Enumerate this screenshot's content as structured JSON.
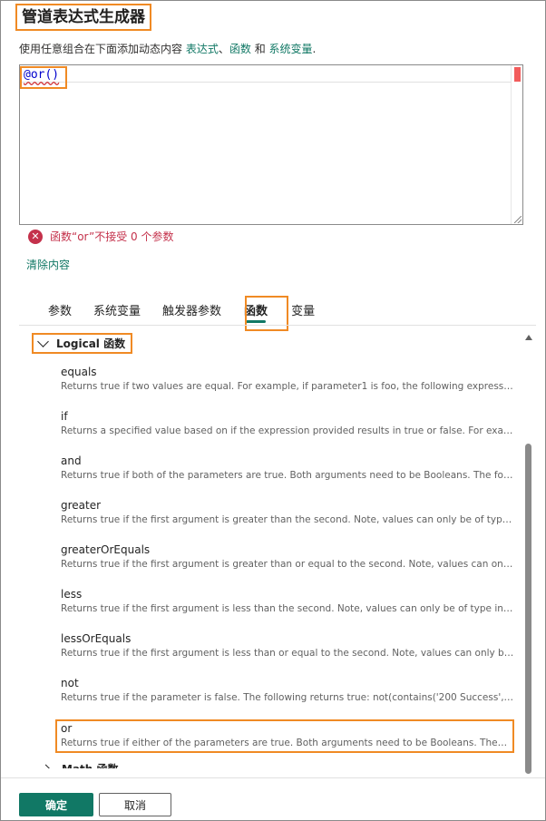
{
  "dialog": {
    "title": "管道表达式生成器",
    "description_prefix": "使用任意组合在下面添加动态内容 ",
    "link_expressions": "表达式",
    "separator": "、",
    "link_functions": "函数",
    "and_word": " 和 ",
    "link_system_variables": "系统变量",
    "description_suffix": "."
  },
  "editor": {
    "code": "@or()"
  },
  "error": {
    "icon": "error-circle-icon",
    "message": "函数“or”不接受 0 个参数"
  },
  "clear_label": "清除内容",
  "tabs": [
    {
      "label": "参数",
      "active": false
    },
    {
      "label": "系统变量",
      "active": false
    },
    {
      "label": "触发器参数",
      "active": false
    },
    {
      "label": "函数",
      "active": true
    },
    {
      "label": "变量",
      "active": false
    }
  ],
  "function_group": {
    "label": "Logical 函数",
    "expanded": true,
    "items": [
      {
        "name": "equals",
        "description": "Returns true if two values are equal. For example, if parameter1 is foo, the following expression would return true"
      },
      {
        "name": "if",
        "description": "Returns a specified value based on if the expression provided results in true or false. For example, the following"
      },
      {
        "name": "and",
        "description": "Returns true if both of the parameters are true. Both arguments need to be Booleans. The following returns false"
      },
      {
        "name": "greater",
        "description": "Returns true if the first argument is greater than the second. Note, values can only be of type integer, float"
      },
      {
        "name": "greaterOrEquals",
        "description": "Returns true if the first argument is greater than or equal to the second. Note, values can only be of type"
      },
      {
        "name": "less",
        "description": "Returns true if the first argument is less than the second. Note, values can only be of type integer, float"
      },
      {
        "name": "lessOrEquals",
        "description": "Returns true if the first argument is less than or equal to the second. Note, values can only be of type integer"
      },
      {
        "name": "not",
        "description": "Returns true if the parameter is false. The following returns true: not(contains('200 Success','Fail'))"
      },
      {
        "name": "or",
        "description": "Returns true if either of the parameters are true. Both arguments need to be Booleans. The following returns true"
      }
    ]
  },
  "next_group": {
    "label": "Math 函数"
  },
  "buttons": {
    "ok": "确定",
    "cancel": "取消"
  },
  "colors": {
    "accent": "#117865",
    "highlight": "#f08a24",
    "error": "#c4314b"
  }
}
